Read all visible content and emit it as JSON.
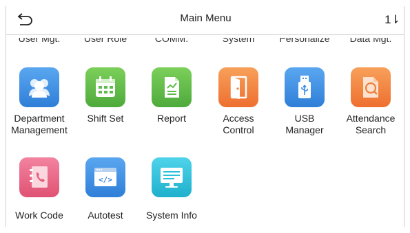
{
  "header": {
    "title": "Main Menu",
    "back_icon": "back-arrow-icon",
    "sort_glyph": "1⇂"
  },
  "partial_row": [
    "User Mgt.",
    "User Role",
    "COMM.",
    "System",
    "Personalize",
    "Data Mgt."
  ],
  "items": [
    {
      "label_lines": [
        "Department",
        "Management"
      ],
      "icon": "department-icon",
      "color": "#3a8ee6"
    },
    {
      "label_lines": [
        "Shift Set"
      ],
      "icon": "shift-calendar-icon",
      "color": "#5cbd4a"
    },
    {
      "label_lines": [
        "Report"
      ],
      "icon": "report-icon",
      "color": "#5cbd4a"
    },
    {
      "label_lines": [
        "Access",
        "Control"
      ],
      "icon": "door-icon",
      "color": "#f0803a"
    },
    {
      "label_lines": [
        "USB",
        "Manager"
      ],
      "icon": "usb-icon",
      "color": "#3a8ee6"
    },
    {
      "label_lines": [
        "Attendance",
        "Search"
      ],
      "icon": "search-doc-icon",
      "color": "#f0803a"
    },
    {
      "label_lines": [
        "Work Code"
      ],
      "icon": "phone-book-icon",
      "color": "#e8607a"
    },
    {
      "label_lines": [
        "Autotest"
      ],
      "icon": "code-window-icon",
      "color": "#3a8ee6"
    },
    {
      "label_lines": [
        "System Info"
      ],
      "icon": "monitor-icon",
      "color": "#2bc0d9"
    }
  ]
}
